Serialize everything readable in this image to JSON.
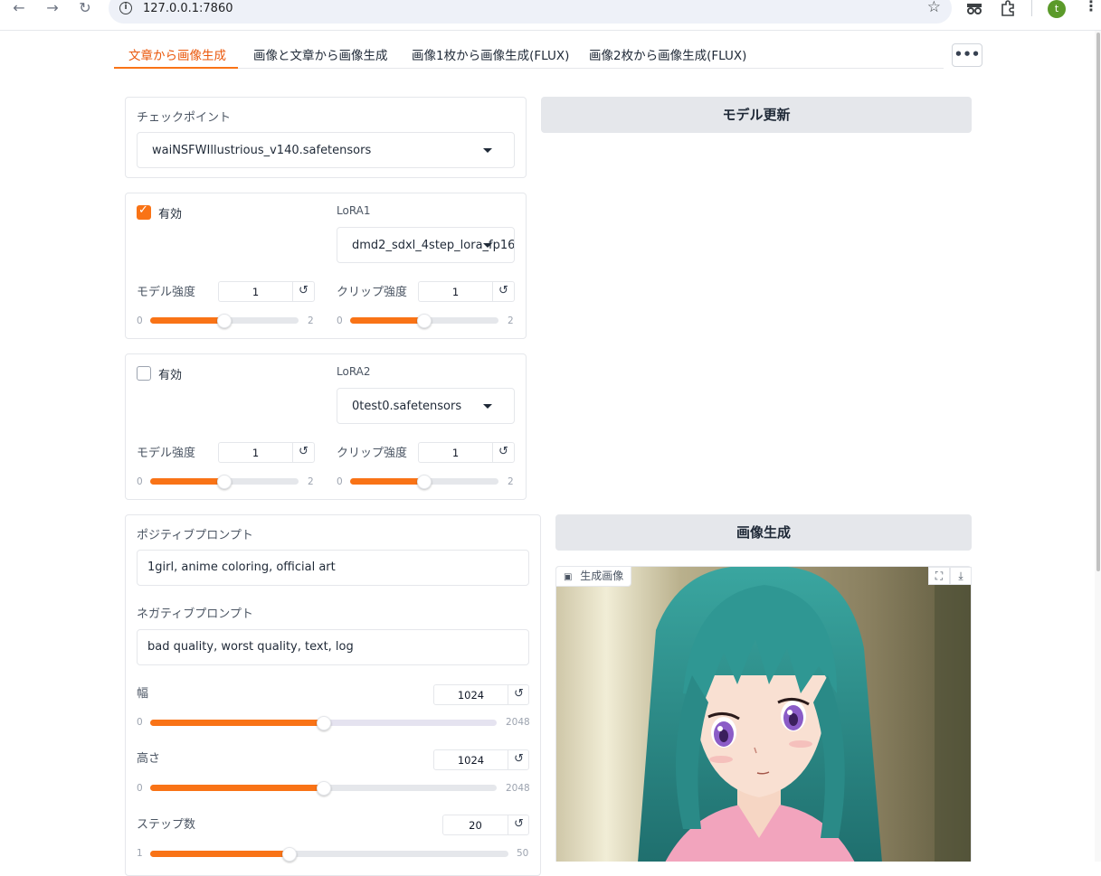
{
  "browser": {
    "url": "127.0.0.1:7860",
    "back_icon": "back-arrow-icon",
    "forward_icon": "forward-arrow-icon",
    "reload_icon": "reload-icon",
    "profile_initial": "t"
  },
  "tabs": [
    {
      "label": "文章から画像生成",
      "active": true
    },
    {
      "label": "画像と文章から画像生成",
      "active": false
    },
    {
      "label": "画像1枚から画像生成(FLUX)",
      "active": false
    },
    {
      "label": "画像2枚から画像生成(FLUX)",
      "active": false
    }
  ],
  "more_label": "•••",
  "checkpoint": {
    "label": "チェックポイント",
    "value": "waiNSFWIllustrious_v140.safetensors"
  },
  "update_button": "モデル更新",
  "lora1": {
    "enabled_label": "有効",
    "enabled": true,
    "lora_label": "LoRA1",
    "lora_value": "dmd2_sdxl_4step_lora_fp16",
    "model_strength_label": "モデル強度",
    "model_strength": "1",
    "clip_strength_label": "クリップ強度",
    "clip_strength": "1",
    "min": "0",
    "max": "2",
    "model_fraction": 0.5,
    "clip_fraction": 0.5
  },
  "lora2": {
    "enabled_label": "有効",
    "enabled": false,
    "lora_label": "LoRA2",
    "lora_value": "0test0.safetensors",
    "model_strength_label": "モデル強度",
    "model_strength": "1",
    "clip_strength_label": "クリップ強度",
    "clip_strength": "1",
    "min": "0",
    "max": "2",
    "model_fraction": 0.5,
    "clip_fraction": 0.5
  },
  "positive": {
    "label": "ポジティブプロンプト",
    "value": "1girl, anime coloring, official art"
  },
  "negative": {
    "label": "ネガティブプロンプト",
    "value": "bad quality, worst quality, text, log"
  },
  "width": {
    "label": "幅",
    "value": "1024",
    "min": "0",
    "max": "2048",
    "fraction": 0.5
  },
  "height": {
    "label": "高さ",
    "value": "1024",
    "min": "0",
    "max": "2048",
    "fraction": 0.5
  },
  "steps": {
    "label": "ステップ数",
    "value": "20",
    "min": "1",
    "max": "50",
    "fraction": 0.388
  },
  "generate_button": "画像生成",
  "output": {
    "badge_label": "生成画像",
    "image_icon": "image-icon",
    "fullscreen_icon": "fullscreen-icon",
    "download_icon": "download-icon"
  },
  "colors": {
    "accent": "#f97316",
    "button_bg": "#e5e7eb"
  }
}
